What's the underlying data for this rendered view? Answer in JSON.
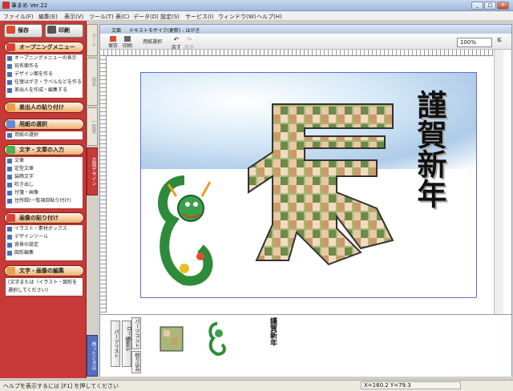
{
  "window": {
    "title": "筆まめ Ver.22",
    "min": "_",
    "max": "□",
    "close": "X"
  },
  "menu": [
    "ファイル(F)",
    "編集(E)",
    "表示(V)",
    "ツール(T)",
    "表(C)",
    "データ(D)",
    "設定(S)",
    "サービス(I)",
    "ウィンドウ(W)",
    "ヘルプ(H)"
  ],
  "left": {
    "save": "保存",
    "print": "印刷",
    "sections": [
      {
        "title": "オープニングメニュー",
        "items": [
          "オープニングメニューの表示",
          "宛名面作る",
          "デザイン面を作る",
          "往復はがき・ラベルなどを作る",
          "差出人を作成・編集する"
        ]
      },
      {
        "title": "差出人の貼り付け",
        "items": []
      },
      {
        "title": "用紙の選択",
        "items": [
          "用紙の選択"
        ]
      },
      {
        "title": "文字・文章の入力",
        "items": [
          "文章",
          "定型文章",
          "装飾文字",
          "吹き出し",
          "付箋・画像",
          "住所録(一覧項目貼り付け)"
        ]
      },
      {
        "title": "画像の貼り付け",
        "items": [
          "イラスト・素材ボックス",
          "デザインツール",
          "背景の設定",
          "図形編集"
        ]
      },
      {
        "title": "文字・画像の編集",
        "items": [
          "(文字または（イラスト・図形を選択してください)"
        ]
      }
    ]
  },
  "tabs": [
    "カード",
    "宛名",
    "一覧表",
    "文面デザイン"
  ],
  "help_tab": "困ったときは",
  "doc": {
    "title_left": "文面",
    "title_main": "テキストモザイク(更新) - はがき",
    "zoom": "100%"
  },
  "toolbar": {
    "save": "保存",
    "print": "印刷",
    "paper": "用紙選択",
    "undo": "戻す",
    "redo": "取消",
    "extra": "拡"
  },
  "card": {
    "greeting": "謹賀新年",
    "thumb_greeting": "謹賀新年"
  },
  "parts": {
    "btn1": "パーツリスト",
    "btn2": "総表示",
    "btn3": "パーツコントロール",
    "btn4": "絞り込み"
  },
  "status": {
    "help": "ヘルプを表示するには [F1] を押してください",
    "coords": "X=160.2 Y=79.3"
  }
}
